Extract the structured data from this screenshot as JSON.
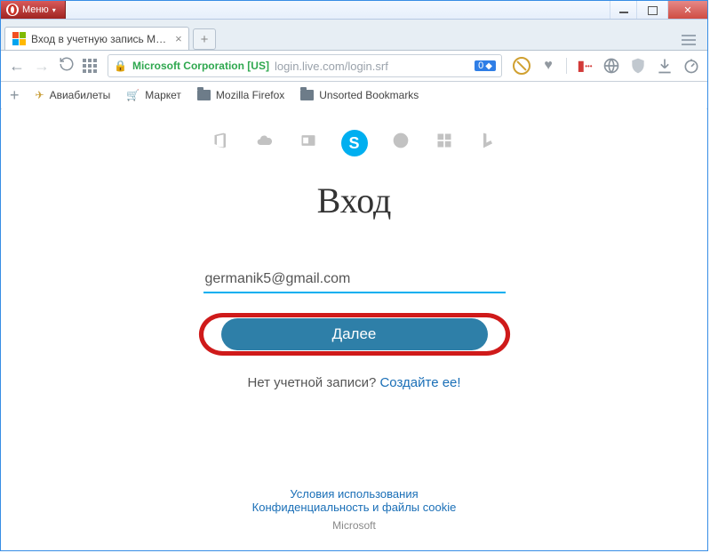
{
  "window": {
    "menu_label": "Меню"
  },
  "tabs": {
    "active_title": "Вход в учетную запись M…"
  },
  "address_bar": {
    "org": "Microsoft Corporation [US]",
    "url": "login.live.com/login.srf",
    "badge": "0"
  },
  "bookmarks": {
    "add_tooltip": "+",
    "items": [
      {
        "label": "Авиабилеты"
      },
      {
        "label": "Маркет"
      },
      {
        "label": "Mozilla Firefox"
      },
      {
        "label": "Unsorted Bookmarks"
      }
    ]
  },
  "page": {
    "heading": "Вход",
    "email_value": "germanik5@gmail.com",
    "next_label": "Далее",
    "no_account_text": "Нет учетной записи?",
    "create_link": "Создайте ее!"
  },
  "footer": {
    "terms": "Условия использования",
    "privacy": "Конфиденциальность и файлы cookie",
    "company": "Microsoft"
  }
}
